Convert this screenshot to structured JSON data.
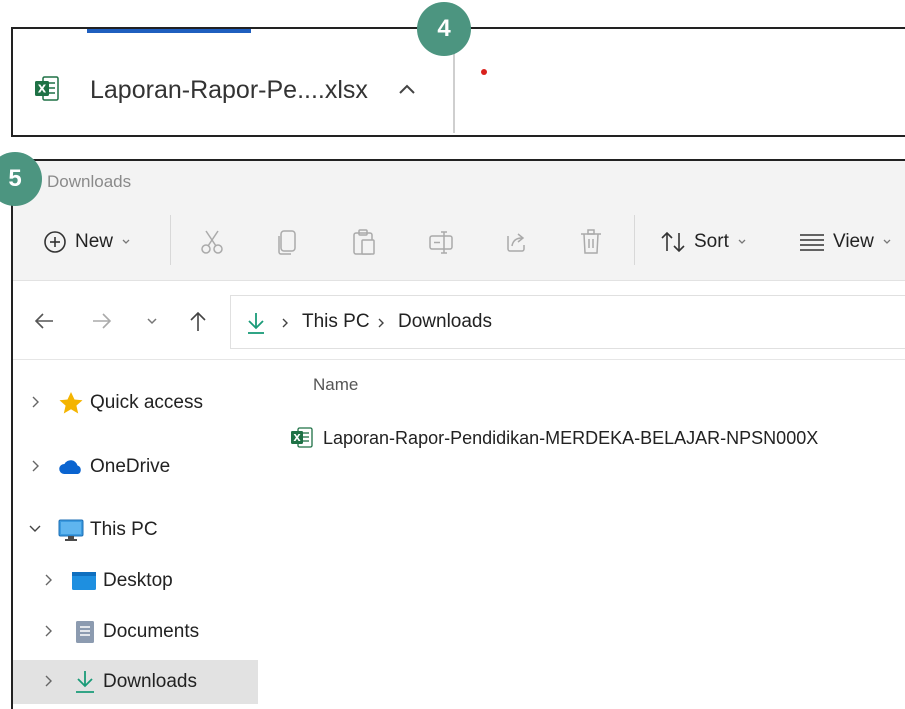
{
  "download_bar": {
    "step_number": "4",
    "file_name": "Laporan-Rapor-Pe....xlsx",
    "file_icon": "excel-file-icon",
    "expand_icon": "chevron-up-icon"
  },
  "explorer": {
    "step_number": "5",
    "window_title": "Downloads",
    "toolbar": {
      "new_label": "New",
      "sort_label": "Sort",
      "view_label": "View",
      "icons": [
        "plus-circle-icon",
        "cut-icon",
        "copy-icon",
        "paste-icon",
        "rename-icon",
        "share-icon",
        "delete-icon",
        "sort-icon",
        "view-icon"
      ]
    },
    "address": {
      "crumbs": [
        "This PC",
        "Downloads"
      ]
    },
    "sidebar": {
      "items": [
        {
          "label": "Quick access",
          "icon": "star-icon"
        },
        {
          "label": "OneDrive",
          "icon": "cloud-icon"
        },
        {
          "label": "This PC",
          "icon": "monitor-icon"
        },
        {
          "label": "Desktop",
          "icon": "desktop-folder-icon"
        },
        {
          "label": "Documents",
          "icon": "documents-icon"
        },
        {
          "label": "Downloads",
          "icon": "download-arrow-icon"
        }
      ]
    },
    "content": {
      "column_name": "Name",
      "files": [
        {
          "name": "Laporan-Rapor-Pendidikan-MERDEKA-BELAJAR-NPSN000X",
          "icon": "excel-file-icon"
        }
      ]
    }
  },
  "colors": {
    "badge": "#4c9580",
    "accent_blue": "#1f5fbf",
    "excel_green": "#1e7145",
    "download_green": "#1a9b78",
    "star": "#f4b400",
    "selected_bg": "#e2e2e2"
  }
}
